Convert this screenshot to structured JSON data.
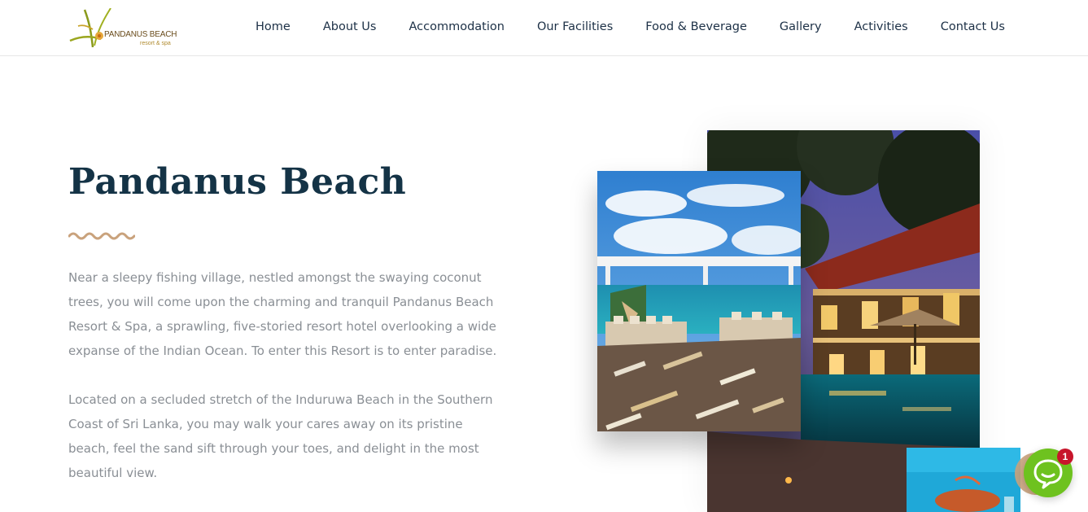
{
  "header": {
    "logo": {
      "name": "PANDANUS BEACH",
      "tagline": "resort & spa"
    },
    "nav": [
      {
        "label": "Home"
      },
      {
        "label": "About Us"
      },
      {
        "label": "Accommodation"
      },
      {
        "label": "Our Facilities"
      },
      {
        "label": "Food & Beverage"
      },
      {
        "label": "Gallery"
      },
      {
        "label": "Activities"
      },
      {
        "label": "Contact Us"
      }
    ]
  },
  "main": {
    "title": "Pandanus Beach",
    "paragraphs": [
      "Near a sleepy fishing village, nestled amongst the swaying coconut trees, you will come upon the charming and tranquil Pandanus Beach Resort & Spa, a sprawling, five-storied resort hotel overlooking a wide expanse of the Indian Ocean. To enter this Resort is to enter paradise.",
      "Located on a secluded stretch of the Induruwa Beach in the Southern Coast of Sri Lanka, you may walk your cares away on its pristine beach, feel the sand sift through your toes, and delight in the most beautiful view."
    ]
  },
  "chat": {
    "badge_count": "1"
  },
  "colors": {
    "title": "#143346",
    "nav": "#1c3046",
    "body_text": "#8a8f95",
    "accent_wave": "#c9a27c",
    "chat_green": "#6ec21f",
    "badge_red": "#c7152b"
  }
}
